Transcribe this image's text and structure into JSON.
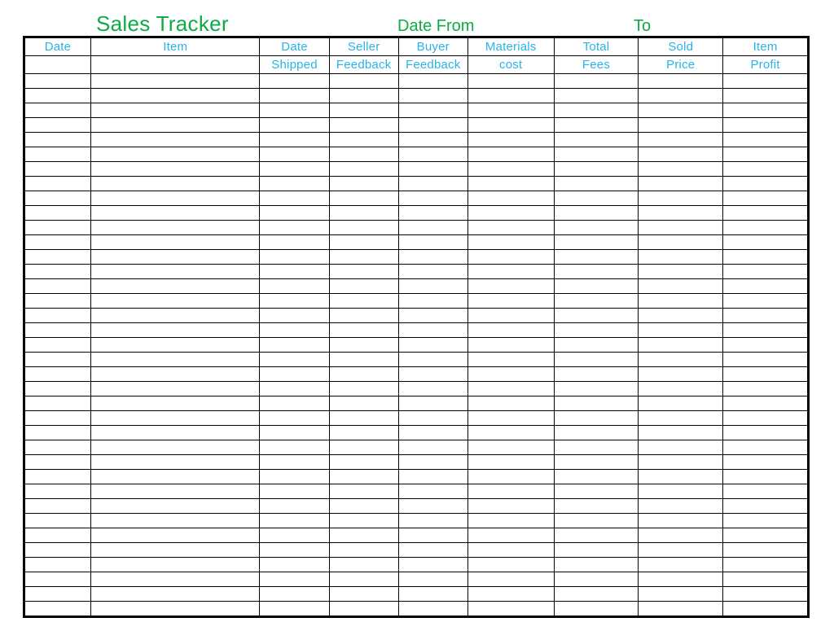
{
  "title": {
    "main": "Sales Tracker",
    "date_from": "Date From",
    "date_to": "To"
  },
  "columns": [
    {
      "line1": "Date",
      "line2": ""
    },
    {
      "line1": "Item",
      "line2": ""
    },
    {
      "line1": "Date",
      "line2": "Shipped"
    },
    {
      "line1": "Seller",
      "line2": "Feedback"
    },
    {
      "line1": "Buyer",
      "line2": "Feedback"
    },
    {
      "line1": "Materials",
      "line2": "cost"
    },
    {
      "line1": "Total",
      "line2": "Fees"
    },
    {
      "line1": "Sold",
      "line2": "Price"
    },
    {
      "line1": "Item",
      "line2": "Profit"
    }
  ],
  "row_count": 37,
  "colors": {
    "green": "#0eab47",
    "cyan": "#29b3e8",
    "border": "#000000"
  },
  "chart_data": {
    "type": "table",
    "title": "Sales Tracker",
    "columns": [
      "Date",
      "Item",
      "Date Shipped",
      "Seller Feedback",
      "Buyer Feedback",
      "Materials cost",
      "Total Fees",
      "Sold Price",
      "Item Profit"
    ],
    "rows": []
  }
}
